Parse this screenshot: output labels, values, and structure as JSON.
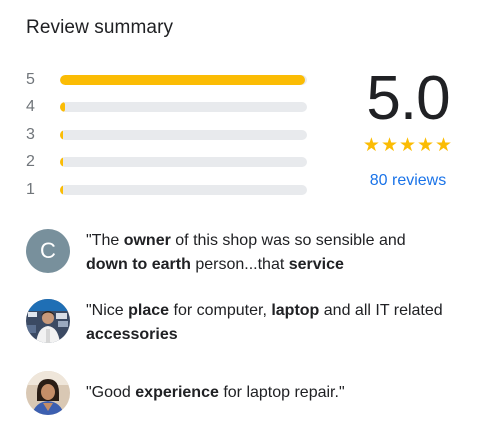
{
  "summary": {
    "title": "Review summary",
    "average_rating": "5.0",
    "stars": "★★★★★",
    "reviews_count_label": "80 reviews"
  },
  "rating_bars": [
    {
      "label": "5",
      "share": 0.99
    },
    {
      "label": "4",
      "share": 0.02
    },
    {
      "label": "3",
      "share": 0.006
    },
    {
      "label": "2",
      "share": 0.006
    },
    {
      "label": "1",
      "share": 0.006
    }
  ],
  "snippets": [
    {
      "avatar_letter": "C",
      "avatar_type": "letter",
      "parts": [
        "\"The ",
        "owner",
        " of this shop was so sensible and ",
        "down to earth",
        " person...that ",
        "service"
      ]
    },
    {
      "avatar_type": "photo-shop",
      "parts": [
        "\"Nice ",
        "place",
        " for computer, ",
        "laptop",
        " and all IT related ",
        "accessories",
        ""
      ]
    },
    {
      "avatar_type": "photo-person",
      "parts": [
        "\"Good ",
        "experience",
        " for laptop repair.\""
      ]
    }
  ],
  "colors": {
    "star_gold": "#fbbc04",
    "bar_track": "#e8eaed",
    "link_blue": "#1a73e8",
    "avatar_grey": "#78909c",
    "text_primary": "#202124",
    "text_secondary": "#70757a"
  },
  "icons": {
    "star": "star-icon"
  }
}
